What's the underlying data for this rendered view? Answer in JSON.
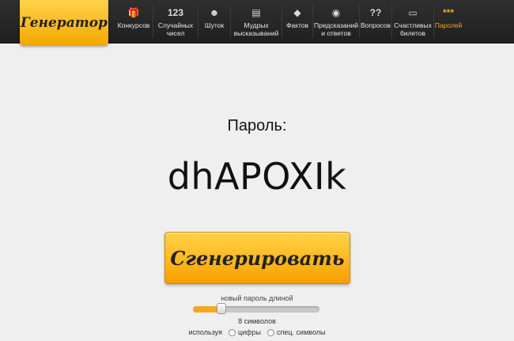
{
  "logo": "Генератор",
  "nav": [
    {
      "id": "contests",
      "icon": "gift-icon",
      "glyph": "🎁",
      "label": "Конкурсов"
    },
    {
      "id": "random",
      "icon": "numbers-icon",
      "glyph": "123",
      "label": "Случайных\nчисел"
    },
    {
      "id": "jokes",
      "icon": "smiley-icon",
      "glyph": "☻",
      "label": "Шуток"
    },
    {
      "id": "quotes",
      "icon": "scroll-icon",
      "glyph": "▤",
      "label": "Мудрых\nвысказываний"
    },
    {
      "id": "facts",
      "icon": "warning-icon",
      "glyph": "◆",
      "label": "Фактов"
    },
    {
      "id": "predictions",
      "icon": "ball-icon",
      "glyph": "◉",
      "label": "Предсказаний\nи ответов"
    },
    {
      "id": "questions",
      "icon": "question-icon",
      "glyph": "??",
      "label": "Вопросов"
    },
    {
      "id": "tickets",
      "icon": "ticket-icon",
      "glyph": "▭",
      "label": "Счастливых\nбилетов"
    },
    {
      "id": "passwords",
      "icon": "asterisks-icon",
      "glyph": "***",
      "label": "Паролей",
      "active": true
    }
  ],
  "main": {
    "caption": "Пароль:",
    "password": "dhAPOXIk",
    "generate_label": "Сгенерировать",
    "length_label": "новый пароль длиной",
    "length_fraction": 0.2,
    "count_label": "8 символов",
    "using_label": "используя",
    "opt_digits": "цифры",
    "opt_special": "спец. символы"
  },
  "colors": {
    "accent": "#f5a623",
    "bar": "#262626",
    "background": "#efefef"
  }
}
